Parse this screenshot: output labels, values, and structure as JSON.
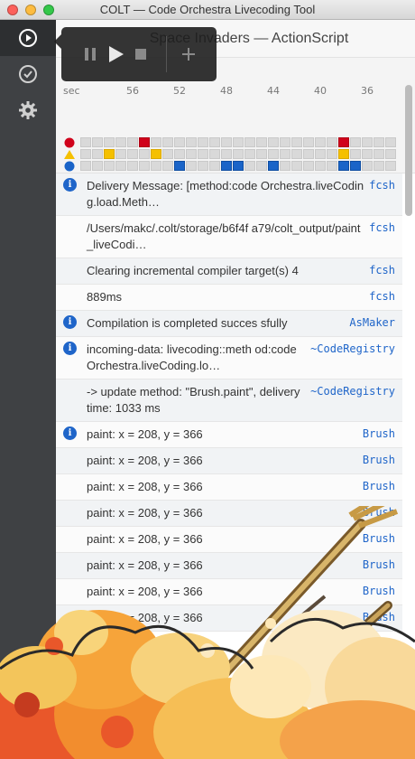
{
  "window": {
    "title": "COLT — Code Orchestra Livecoding Tool"
  },
  "sidebar": {
    "items": [
      "play-circle-icon",
      "check-circle-icon",
      "gear-icon"
    ]
  },
  "project": {
    "name": "Space Invaders — ActionScript"
  },
  "timeline": {
    "unit_label": "sec",
    "ticks": [
      "56",
      "52",
      "48",
      "44",
      "40",
      "36"
    ],
    "rows": [
      {
        "marker": "red-circle",
        "color": "#d0021b",
        "cells": [
          0,
          0,
          0,
          0,
          0,
          1,
          0,
          0,
          0,
          0,
          0,
          0,
          0,
          0,
          0,
          0,
          0,
          0,
          0,
          0,
          0,
          0,
          1,
          0,
          0,
          0,
          0
        ]
      },
      {
        "marker": "yellow-triangle",
        "color": "#f5c000",
        "cells": [
          0,
          0,
          1,
          0,
          0,
          0,
          1,
          0,
          0,
          0,
          0,
          0,
          0,
          0,
          0,
          0,
          0,
          0,
          0,
          0,
          0,
          0,
          1,
          0,
          0,
          0,
          0
        ]
      },
      {
        "marker": "blue-circle",
        "color": "#1a64c8",
        "cells": [
          0,
          0,
          0,
          0,
          0,
          0,
          0,
          0,
          1,
          0,
          0,
          0,
          1,
          1,
          0,
          0,
          1,
          0,
          0,
          0,
          0,
          0,
          1,
          1,
          0,
          0,
          0
        ]
      }
    ]
  },
  "log": [
    {
      "info": true,
      "message": "Delivery Message: [method:code Orchestra.liveCoding.load.Meth…",
      "source": "fcsh"
    },
    {
      "info": false,
      "message": "/Users/makc/.colt/storage/b6f4f a79/colt_output/paint_liveCodi…",
      "source": "fcsh"
    },
    {
      "info": false,
      "message": "Clearing incremental compiler target(s) 4",
      "source": "fcsh"
    },
    {
      "info": false,
      "message": "889ms",
      "source": "fcsh"
    },
    {
      "info": true,
      "message": "Compilation is completed succes sfully",
      "source": "AsMaker"
    },
    {
      "info": true,
      "message": "incoming-data: livecoding::meth od:codeOrchestra.liveCoding.lo…",
      "source": "~CodeRegistry"
    },
    {
      "info": false,
      "message": "-> update method: \"Brush.paint\", delivery time: 1033 ms",
      "source": "~CodeRegistry"
    },
    {
      "info": true,
      "message": "paint: x = 208, y = 366",
      "source": "Brush"
    },
    {
      "info": false,
      "message": "paint: x = 208, y = 366",
      "source": "Brush"
    },
    {
      "info": false,
      "message": "paint: x = 208, y = 366",
      "source": "Brush"
    },
    {
      "info": false,
      "message": "paint: x = 208, y = 366",
      "source": "Brush"
    },
    {
      "info": false,
      "message": "paint: x = 208, y = 366",
      "source": "Brush"
    },
    {
      "info": false,
      "message": "paint: x = 208, y = 366",
      "source": "Brush"
    },
    {
      "info": false,
      "message": "paint: x = 208, y = 366",
      "source": "Brush"
    },
    {
      "info": false,
      "message": "paint: x = 208, y = 366",
      "source": "Brush"
    }
  ],
  "playback": {
    "buttons": [
      "pause-icon",
      "play-icon",
      "stop-icon",
      "add-icon"
    ]
  }
}
